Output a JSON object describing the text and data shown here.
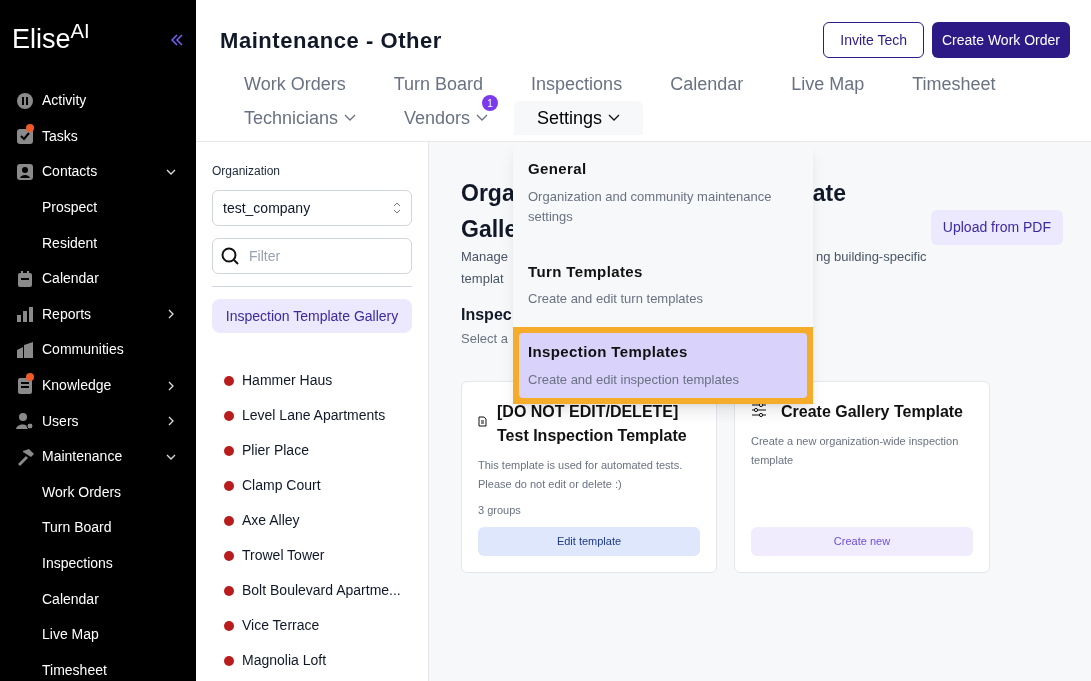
{
  "sidebar": {
    "logo": {
      "text": "Elise",
      "superscript": "AI"
    },
    "items": [
      {
        "label": "Activity",
        "badge": false
      },
      {
        "label": "Tasks",
        "badge": true
      },
      {
        "label": "Contacts",
        "badge": false,
        "expanded": true,
        "children": [
          {
            "label": "Prospect"
          },
          {
            "label": "Resident"
          }
        ]
      },
      {
        "label": "Calendar",
        "badge": false
      },
      {
        "label": "Reports",
        "badge": false,
        "expanded": false
      },
      {
        "label": "Communities",
        "badge": false
      },
      {
        "label": "Knowledge",
        "badge": true,
        "expanded": false
      },
      {
        "label": "Users",
        "badge": false,
        "expanded": false
      },
      {
        "label": "Maintenance",
        "badge": false,
        "expanded": true,
        "children": [
          {
            "label": "Work Orders"
          },
          {
            "label": "Turn Board"
          },
          {
            "label": "Inspections"
          },
          {
            "label": "Calendar"
          },
          {
            "label": "Live Map"
          },
          {
            "label": "Timesheet"
          }
        ]
      }
    ]
  },
  "header": {
    "title": "Maintenance - Other",
    "buttons": [
      {
        "label": "Invite Tech",
        "kind": "outline"
      },
      {
        "label": "Create Work Order",
        "kind": "primary"
      }
    ]
  },
  "tabs": [
    [
      {
        "label": "Work Orders",
        "selected": false
      },
      {
        "label": "Turn Board",
        "selected": false
      },
      {
        "label": "Inspections",
        "selected": false
      },
      {
        "label": "Calendar",
        "selected": false
      },
      {
        "label": "Live Map",
        "selected": false
      },
      {
        "label": "Timesheet",
        "selected": false
      }
    ],
    [
      {
        "label": "Technicians",
        "dropdown": true,
        "selected": false
      },
      {
        "label": "Vendors",
        "dropdown": true,
        "badge": "1",
        "selected": false
      },
      {
        "label": "Settings",
        "dropdown": true,
        "selected": true
      }
    ]
  ],
  "settings_menu": [
    {
      "title": "General",
      "description": "Organization and community maintenance settings",
      "selected": false
    },
    {
      "title": "Turn Templates",
      "description": "Create and edit turn templates",
      "selected": false
    },
    {
      "title": "Inspection Templates",
      "description": "Create and edit inspection templates",
      "selected": true
    }
  ],
  "left_panel": {
    "organization_label": "Organization",
    "organization": "test_company",
    "filter_placeholder": "Filter",
    "gallery_button": "Inspection Template Gallery",
    "properties": [
      "Hammer Haus",
      "Level Lane Apartments",
      "Plier Place",
      "Clamp Court",
      "Axe Alley",
      "Trowel Tower",
      "Bolt Boulevard Apartme...",
      "Vice Terrace",
      "Magnolia Loft"
    ]
  },
  "main": {
    "title_fragments": [
      "Orga",
      "ate",
      "Galle"
    ],
    "description_fragments": [
      "Manage",
      "ng building-specific",
      "templat"
    ],
    "section_title_fragment": "Inspec",
    "section_subtitle_fragment": "Select a",
    "upload_button": "Upload from PDF",
    "cards": [
      {
        "kind": "template",
        "title": "[DO NOT EDIT/DELETE] Test Inspection Template",
        "description": "This template is used for automated tests. Please do not edit or delete :)",
        "meta": "3 groups",
        "button": "Edit template"
      },
      {
        "kind": "create",
        "title": "Create Gallery Template",
        "description": "Create a new organization-wide inspection template",
        "button": "Create new"
      }
    ]
  }
}
